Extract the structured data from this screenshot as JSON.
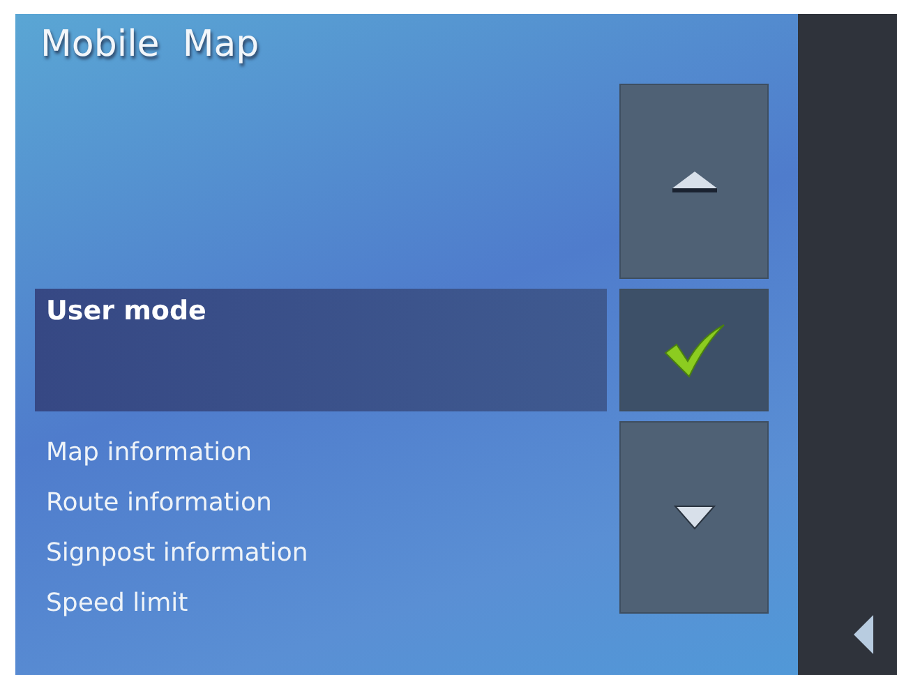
{
  "title": "Mobile  Map",
  "current_option": {
    "label": "User mode",
    "checked": true
  },
  "items": [
    "Map information",
    "Route information",
    "Signpost information",
    "Speed limit"
  ]
}
